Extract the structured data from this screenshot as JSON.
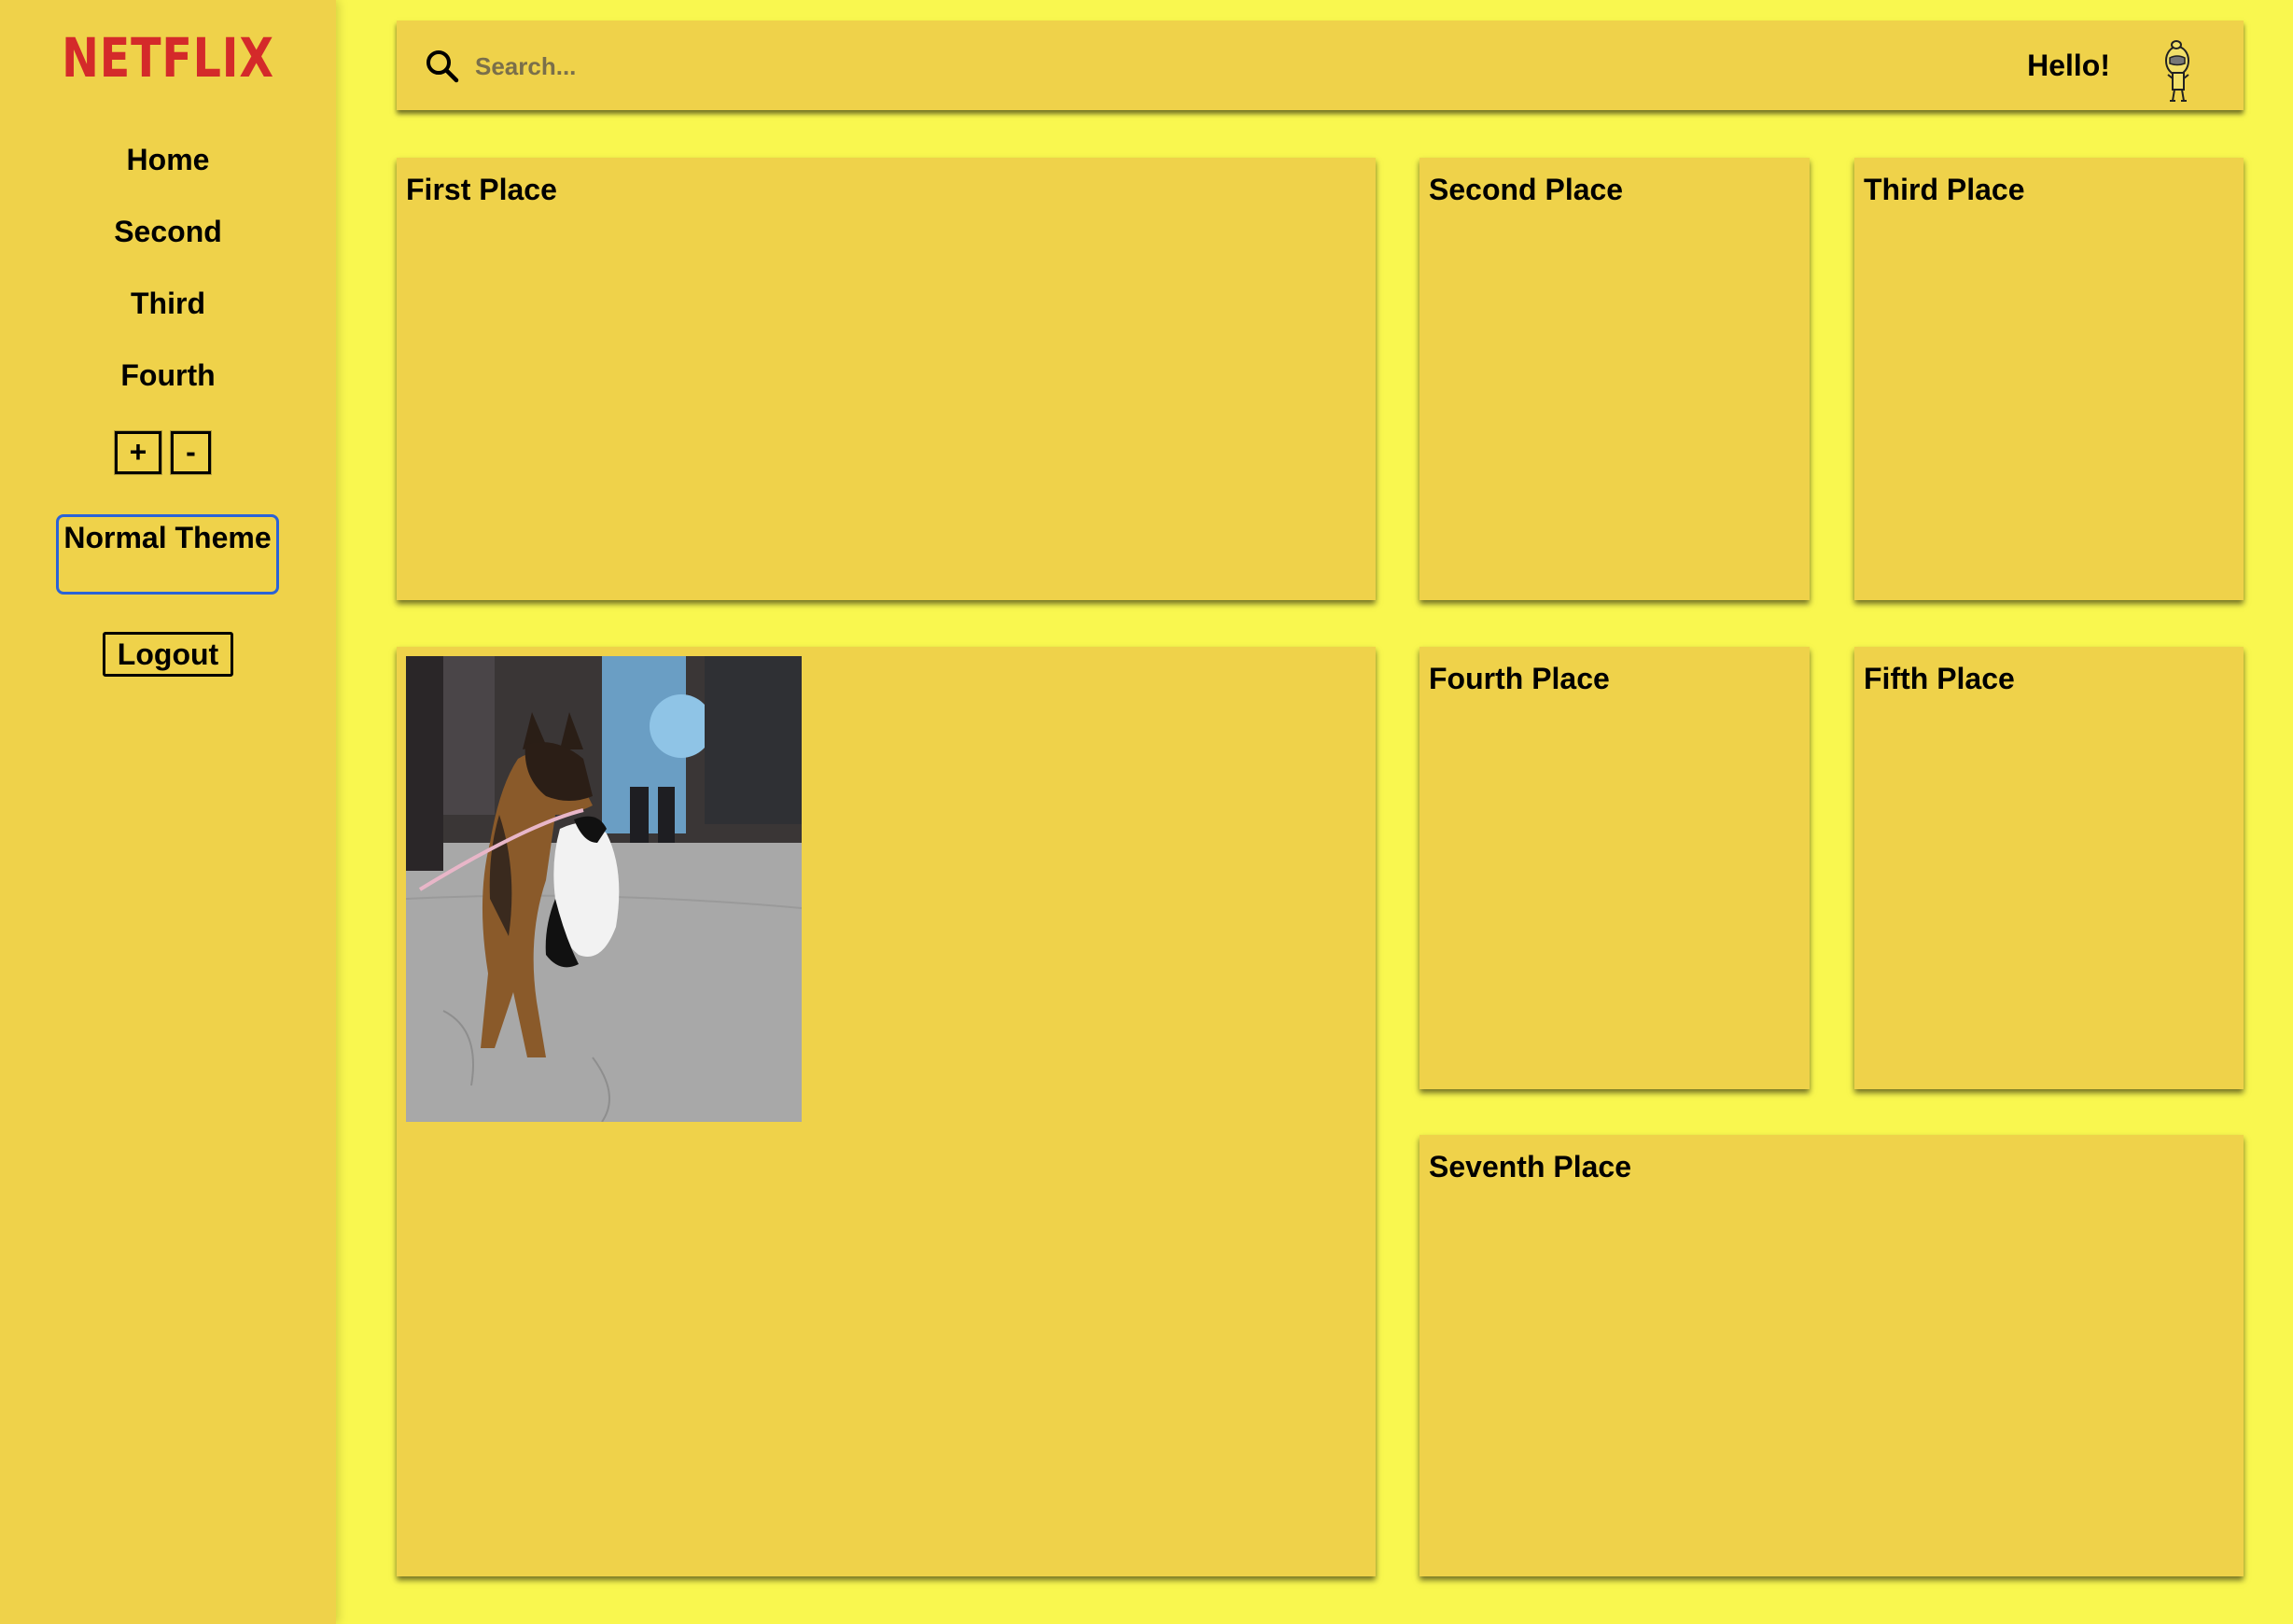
{
  "sidebar": {
    "logo": "NETFLIX",
    "nav": [
      "Home",
      "Second",
      "Third",
      "Fourth"
    ],
    "zoom_in_label": "+",
    "zoom_out_label": "-",
    "theme_label": "Normal Theme",
    "logout_label": "Logout"
  },
  "header": {
    "search_placeholder": "Search...",
    "greeting": "Hello!"
  },
  "cards": {
    "first": "First Place",
    "second": "Second Place",
    "third": "Third Place",
    "fourth": "Fourth Place",
    "fifth": "Fifth Place",
    "seventh": "Seventh Place"
  },
  "colors": {
    "background": "#f9f74f",
    "panel": "#efd24a",
    "logo": "#d42a2a",
    "focus_ring": "#2b63d6"
  },
  "icons": {
    "search": "search-icon",
    "avatar": "avatar-icon"
  }
}
